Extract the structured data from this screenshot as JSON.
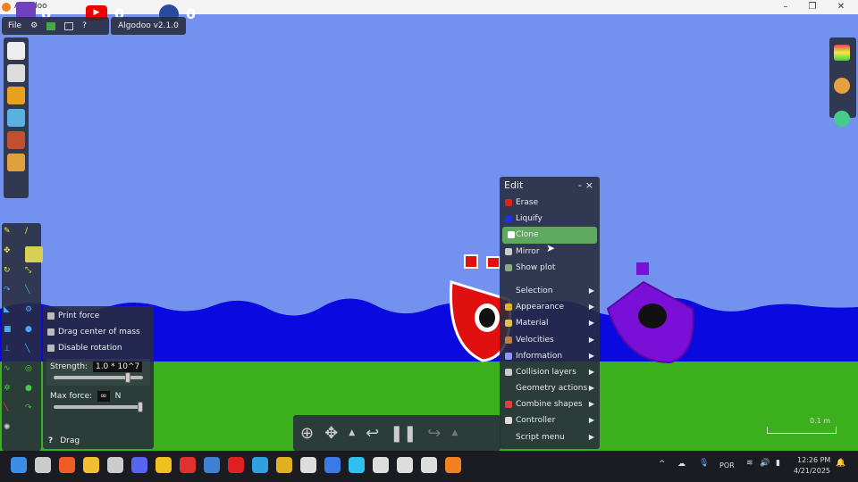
{
  "window": {
    "title": "Algodoo",
    "minimize": "–",
    "maximize": "❐",
    "close": "✕"
  },
  "overlay": {
    "twitch_count": "0",
    "youtube_count": "0",
    "facebook_count": "0"
  },
  "topbar": {
    "file": "File",
    "help": "?",
    "version": "Algodoo v2.1.0"
  },
  "edit_menu": {
    "title": "Edit",
    "min": "-",
    "close": "×",
    "items": [
      {
        "label": "Erase",
        "icon": "erase-icon",
        "color": "#e02020",
        "submenu": false
      },
      {
        "label": "Liquify",
        "icon": "liquify-icon",
        "color": "#2030e0",
        "submenu": false
      },
      {
        "label": "Clone",
        "icon": "clone-icon",
        "color": "#ffffff",
        "submenu": false,
        "highlighted": true
      },
      {
        "label": "Mirror",
        "icon": "mirror-icon",
        "color": "#cccccc",
        "submenu": false
      },
      {
        "label": "Show plot",
        "icon": "plot-icon",
        "color": "#88aa88",
        "submenu": false
      },
      {
        "label": "Selection",
        "icon": "",
        "color": "",
        "submenu": true
      },
      {
        "label": "Appearance",
        "icon": "appearance-icon",
        "color": "#e0b030",
        "submenu": true
      },
      {
        "label": "Material",
        "icon": "material-icon",
        "color": "#e0c050",
        "submenu": true
      },
      {
        "label": "Velocities",
        "icon": "velocities-icon",
        "color": "#c08040",
        "submenu": true
      },
      {
        "label": "Information",
        "icon": "info-icon",
        "color": "#8899ff",
        "submenu": true
      },
      {
        "label": "Collision layers",
        "icon": "collision-icon",
        "color": "#cccccc",
        "submenu": true
      },
      {
        "label": "Geometry actions",
        "icon": "",
        "color": "",
        "submenu": true
      },
      {
        "label": "Combine shapes",
        "icon": "combine-icon",
        "color": "#e04040",
        "submenu": true
      },
      {
        "label": "Controller",
        "icon": "controller-icon",
        "color": "#dddddd",
        "submenu": true
      },
      {
        "label": "Script menu",
        "icon": "",
        "color": "",
        "submenu": true
      }
    ],
    "submenu_arrow": "▶"
  },
  "drag_options": {
    "print_force": "Print force",
    "drag_center": "Drag center of mass",
    "disable_rotation": "Disable rotation",
    "strength_label": "Strength:",
    "strength_value": "1.0 * 10^7",
    "strength_slider": 0.8,
    "max_force_label": "Max force:",
    "max_force_value": "∞",
    "max_force_unit": "N",
    "max_force_slider": 1.0,
    "help": "?",
    "tool_name": "Drag"
  },
  "scale": {
    "label": "0.1 m"
  },
  "taskbar": {
    "lang": "POR",
    "time": "12:26 PM",
    "date": "4/21/2025",
    "chevron": "^"
  },
  "colors": {
    "sky": "#7391ef",
    "water": "#0a0ae0",
    "ground": "#3cb01c",
    "accent": "#5fa85f"
  }
}
